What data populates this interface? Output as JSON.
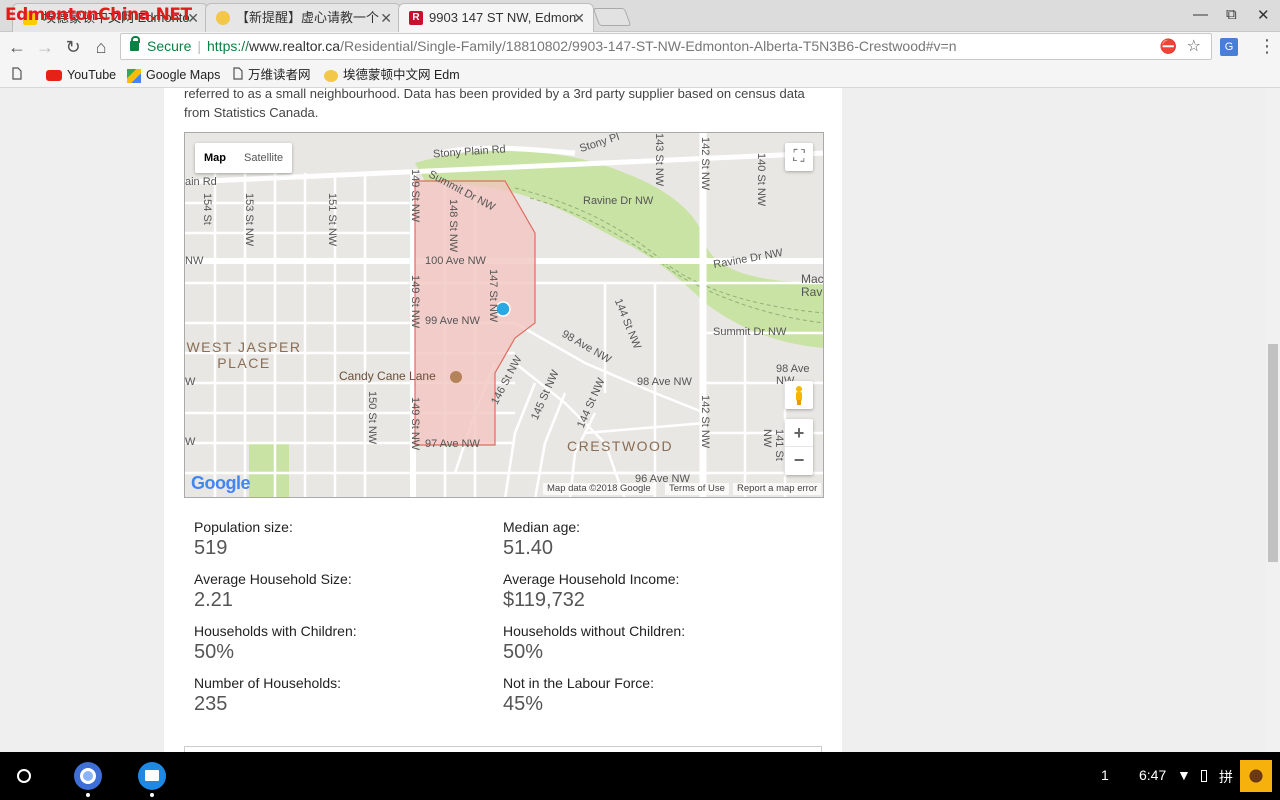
{
  "browser": {
    "tabs": [
      {
        "title": "埃德蒙顿中文网 Edmonto",
        "active": false
      },
      {
        "title": "【新提醒】虚心请教一个",
        "active": false
      },
      {
        "title": "9903 147 ST NW, Edmon",
        "active": true
      }
    ],
    "watermark": "EdmontonChina.NET",
    "omnibox": {
      "secure_label": "Secure",
      "url_scheme": "https://",
      "url_host": "www.realtor.ca",
      "url_path": "/Residential/Single-Family/18810802/9903-147-ST-NW-Edmonton-Alberta-T5N3B6-Crestwood#v=n"
    },
    "bookmarks": [
      "YouTube",
      "Google Maps",
      "万维读者网",
      "埃德蒙顿中文网 Edmo"
    ]
  },
  "page": {
    "intro_text": "referred to as a small neighbourhood. Data has been provided by a 3rd party supplier based on census data from Statistics Canada.",
    "map": {
      "type_map": "Map",
      "type_satellite": "Satellite",
      "zoom_in": "+",
      "zoom_out": "−",
      "attribution_data": "Map data ©2018 Google",
      "attribution_terms": "Terms of Use",
      "attribution_report": "Report a map error",
      "labels": {
        "stony_plain": "Stony Plain Rd",
        "stony_pl2": "Stony Pl",
        "summit_dr": "Summit Dr NW",
        "summit_dr2": "Summit Dr NW",
        "ravine_dr": "Ravine Dr NW",
        "ravine_dr2": "Ravine Dr NW",
        "mac_rav": "Mac\nRav",
        "ave100": "100 Ave NW",
        "ave99": "99 Ave NW",
        "ave98": "98 Ave NW",
        "ave98b": "98 Ave NW",
        "ave98c": "98 Ave NW",
        "ave97": "97 Ave NW",
        "ave96": "96 Ave NW",
        "west_jasper": "WEST JASPER\nPLACE",
        "crestwood": "CRESTWOOD",
        "candy_cane": "Candy Cane Lane",
        "st149": "149 St NW",
        "st149b": "149 St NW",
        "st149c": "149 St NW",
        "st148": "148 St NW",
        "st147": "147 St NW",
        "st146": "146 St NW",
        "st145": "145 St NW",
        "st144": "144 St NW",
        "st144b": "144 St NW",
        "st143": "143 St NW",
        "st142": "142 St NW",
        "st142b": "142 St NW",
        "st141": "141 St NW",
        "st140": "140 St NW",
        "st150": "150 St NW",
        "st151": "151 St NW",
        "st153": "153 St NW",
        "st154": "154 St",
        "ainrd": "ain Rd",
        "nw_left": "NW",
        "w_left1": "W",
        "w_left2": "W",
        "w_left3": "W",
        "google": "Google"
      }
    },
    "stats": [
      {
        "label": "Population size:",
        "value": "519"
      },
      {
        "label": "Median age:",
        "value": "51.40"
      },
      {
        "label": "Average Household Size:",
        "value": "2.21"
      },
      {
        "label": "Average Household Income:",
        "value": "$119,732"
      },
      {
        "label": "Households with Children:",
        "value": "50%"
      },
      {
        "label": "Households without Children:",
        "value": "50%"
      },
      {
        "label": "Number of Households:",
        "value": "235"
      },
      {
        "label": "Not in the Labour Force:",
        "value": "45%"
      }
    ]
  },
  "shelf": {
    "notification_count": "1",
    "time": "6:47",
    "ime": "拼"
  },
  "colors": {
    "park_green": "#c9e3a4",
    "neighbourhood_fill": "#f3c6c1",
    "neighbourhood_stroke": "#e06b60",
    "marker": "#2ba8e0",
    "secure_green": "#0b8043"
  }
}
